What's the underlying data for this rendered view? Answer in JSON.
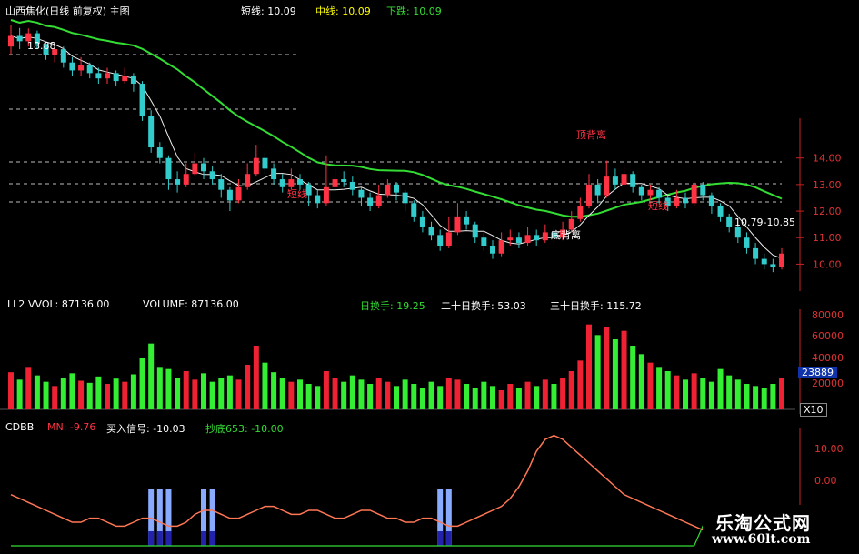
{
  "title": "山西焦化(日线 前复权) 主图",
  "legend_main": [
    {
      "label": "短线: 10.09",
      "color": "#ffffff"
    },
    {
      "label": "中线: 10.09",
      "color": "#ffff00"
    },
    {
      "label": "下跌: 10.09",
      "color": "#33dd33"
    }
  ],
  "annotations": {
    "high": "18.88",
    "short_line": "短线",
    "top_div": "顶背离",
    "bottom_div": "底背离",
    "range": "10.79-10.85",
    "short_line2": "短线"
  },
  "vol_header": {
    "name": "LL2",
    "vvol": "VVOL: 87136.00",
    "volume": "VOLUME: 87136.00",
    "t10": "日换手: 19.25",
    "t20": "二十日换手: 53.03",
    "t30": "三十日换手: 115.72"
  },
  "vol_axis": {
    "ticks": [
      "80000",
      "60000",
      "40000",
      "20000"
    ],
    "current": "23889",
    "unit": "X10"
  },
  "ind_header": {
    "name": "CDBB",
    "mn": "MN: -9.76",
    "buy": "买入信号: -10.03",
    "bottom": "抄底653: -10.00"
  },
  "ind_axis": {
    "ticks": [
      "10.00",
      "0.00"
    ]
  },
  "watermark": {
    "cn": "乐淘公式网",
    "url": "www.60lt.com"
  },
  "colors": {
    "up": "#ff3344",
    "down": "#33cccc",
    "vol_up": "#ee2233",
    "vol_down": "#33ee33",
    "axis": "#cc2222"
  },
  "chart_data": {
    "type": "candlestick",
    "price_axis": {
      "ticks": [
        14.0,
        13.0,
        12.0,
        11.0,
        10.0
      ],
      "ylim": [
        9.5,
        19.2
      ]
    },
    "candles": [
      [
        18.2,
        18.6,
        19.0,
        17.9
      ],
      [
        18.6,
        18.4,
        18.9,
        18.1
      ],
      [
        18.4,
        18.7,
        18.88,
        18.2
      ],
      [
        18.7,
        18.3,
        18.8,
        18.1
      ],
      [
        18.3,
        17.9,
        18.4,
        17.7
      ],
      [
        17.9,
        18.1,
        18.3,
        17.6
      ],
      [
        18.1,
        17.6,
        18.2,
        17.4
      ],
      [
        17.6,
        17.3,
        17.8,
        17.1
      ],
      [
        17.3,
        17.5,
        17.8,
        17.1
      ],
      [
        17.5,
        17.2,
        17.6,
        17.0
      ],
      [
        17.2,
        17.0,
        17.4,
        16.8
      ],
      [
        17.0,
        17.2,
        17.4,
        16.8
      ],
      [
        17.2,
        16.9,
        17.3,
        16.7
      ],
      [
        16.9,
        17.1,
        17.4,
        16.8
      ],
      [
        17.1,
        16.8,
        17.2,
        16.5
      ],
      [
        16.8,
        15.6,
        16.9,
        15.4
      ],
      [
        15.6,
        14.4,
        15.8,
        14.2
      ],
      [
        14.4,
        14.0,
        14.6,
        13.8
      ],
      [
        14.0,
        13.2,
        14.1,
        12.8
      ],
      [
        13.2,
        13.0,
        13.5,
        12.7
      ],
      [
        13.0,
        13.4,
        13.8,
        12.9
      ],
      [
        13.4,
        13.8,
        14.2,
        13.3
      ],
      [
        13.8,
        13.5,
        14.0,
        13.2
      ],
      [
        13.5,
        13.2,
        13.7,
        13.0
      ],
      [
        13.2,
        12.8,
        13.4,
        12.5
      ],
      [
        12.8,
        12.4,
        12.9,
        12.0
      ],
      [
        12.4,
        12.9,
        13.2,
        12.3
      ],
      [
        12.9,
        13.4,
        13.8,
        12.8
      ],
      [
        13.4,
        14.0,
        14.5,
        13.3
      ],
      [
        14.0,
        13.6,
        14.2,
        13.4
      ],
      [
        13.6,
        13.2,
        13.8,
        13.0
      ],
      [
        13.2,
        12.9,
        13.4,
        12.7
      ],
      [
        12.9,
        13.2,
        13.6,
        12.8
      ],
      [
        13.2,
        13.0,
        13.4,
        12.8
      ],
      [
        13.0,
        12.6,
        13.1,
        12.2
      ],
      [
        12.6,
        12.3,
        12.8,
        12.1
      ],
      [
        12.3,
        12.9,
        14.1,
        12.2
      ],
      [
        12.9,
        13.2,
        13.6,
        12.8
      ],
      [
        13.2,
        13.1,
        13.5,
        12.9
      ],
      [
        13.1,
        12.8,
        13.3,
        12.6
      ],
      [
        12.8,
        12.5,
        12.9,
        12.2
      ],
      [
        12.5,
        12.2,
        12.7,
        12.0
      ],
      [
        12.2,
        12.6,
        13.0,
        12.1
      ],
      [
        12.6,
        13.0,
        13.2,
        12.5
      ],
      [
        13.0,
        12.7,
        13.1,
        12.4
      ],
      [
        12.7,
        12.3,
        12.8,
        12.0
      ],
      [
        12.3,
        11.8,
        12.4,
        11.6
      ],
      [
        11.8,
        11.4,
        12.0,
        11.2
      ],
      [
        11.4,
        11.1,
        11.6,
        10.9
      ],
      [
        11.1,
        10.7,
        11.3,
        10.5
      ],
      [
        10.7,
        11.2,
        11.8,
        10.6
      ],
      [
        11.2,
        11.8,
        12.3,
        11.1
      ],
      [
        11.8,
        11.5,
        12.0,
        11.3
      ],
      [
        11.5,
        11.0,
        11.6,
        10.8
      ],
      [
        11.0,
        10.7,
        11.2,
        10.5
      ],
      [
        10.7,
        10.4,
        10.9,
        10.2
      ],
      [
        10.4,
        10.9,
        11.2,
        10.3
      ],
      [
        10.9,
        11.0,
        11.3,
        10.7
      ],
      [
        11.0,
        10.8,
        11.2,
        10.6
      ],
      [
        10.8,
        11.1,
        11.4,
        10.7
      ],
      [
        11.1,
        10.9,
        11.3,
        10.7
      ],
      [
        10.9,
        11.2,
        11.5,
        10.8
      ],
      [
        11.2,
        11.0,
        11.4,
        10.8
      ],
      [
        11.0,
        11.3,
        11.6,
        10.9
      ],
      [
        11.3,
        11.7,
        12.0,
        11.2
      ],
      [
        11.7,
        12.2,
        12.5,
        11.6
      ],
      [
        12.2,
        13.0,
        13.4,
        12.1
      ],
      [
        13.0,
        12.6,
        13.2,
        12.3
      ],
      [
        12.6,
        13.3,
        13.9,
        12.5
      ],
      [
        13.3,
        13.0,
        13.6,
        12.8
      ],
      [
        13.0,
        13.4,
        13.7,
        12.9
      ],
      [
        13.4,
        12.9,
        13.5,
        12.7
      ],
      [
        12.9,
        12.6,
        13.0,
        12.4
      ],
      [
        12.6,
        12.8,
        13.0,
        12.4
      ],
      [
        12.8,
        12.5,
        12.9,
        12.3
      ],
      [
        12.5,
        12.2,
        12.6,
        12.0
      ],
      [
        12.2,
        12.5,
        12.8,
        12.1
      ],
      [
        12.5,
        12.3,
        12.7,
        12.1
      ],
      [
        12.3,
        13.0,
        13.1,
        12.2
      ],
      [
        13.0,
        12.6,
        13.1,
        12.4
      ],
      [
        12.6,
        12.2,
        12.7,
        11.9
      ],
      [
        12.2,
        11.8,
        12.3,
        11.6
      ],
      [
        11.8,
        11.4,
        11.9,
        11.2
      ],
      [
        11.4,
        11.0,
        11.5,
        10.8
      ],
      [
        11.0,
        10.6,
        11.2,
        10.4
      ],
      [
        10.6,
        10.2,
        10.8,
        10.0
      ],
      [
        10.2,
        10.0,
        10.4,
        9.8
      ],
      [
        10.0,
        9.9,
        10.2,
        9.7
      ],
      [
        9.9,
        10.4,
        10.6,
        9.8
      ]
    ],
    "volume": [
      35,
      28,
      40,
      32,
      26,
      22,
      30,
      34,
      27,
      25,
      31,
      24,
      29,
      26,
      33,
      48,
      62,
      40,
      38,
      30,
      36,
      28,
      34,
      26,
      30,
      32,
      28,
      42,
      60,
      44,
      35,
      30,
      26,
      28,
      24,
      22,
      36,
      30,
      26,
      32,
      28,
      24,
      30,
      26,
      22,
      28,
      24,
      20,
      26,
      22,
      30,
      28,
      24,
      20,
      26,
      22,
      18,
      24,
      20,
      26,
      22,
      28,
      24,
      30,
      36,
      46,
      80,
      70,
      78,
      66,
      74,
      60,
      52,
      44,
      40,
      36,
      32,
      28,
      34,
      30,
      26,
      38,
      32,
      28,
      24,
      22,
      20,
      24,
      30
    ],
    "indicator": [
      -1,
      -2,
      -3,
      -4,
      -5,
      -6,
      -7,
      -8,
      -8,
      -7,
      -7,
      -8,
      -9,
      -9,
      -8,
      -7,
      -7,
      -8,
      -9,
      -9,
      -8,
      -6,
      -5,
      -5,
      -6,
      -7,
      -7,
      -6,
      -5,
      -4,
      -4,
      -5,
      -6,
      -6,
      -5,
      -5,
      -6,
      -7,
      -7,
      -6,
      -5,
      -5,
      -6,
      -7,
      -7,
      -8,
      -8,
      -7,
      -7,
      -8,
      -9,
      -9,
      -8,
      -7,
      -6,
      -5,
      -4,
      -2,
      1,
      5,
      10,
      13,
      14,
      13,
      11,
      9,
      7,
      5,
      3,
      1,
      -1,
      -2,
      -3,
      -4,
      -5,
      -6,
      -7,
      -8,
      -9,
      -10,
      -10,
      -11,
      -11,
      -11,
      -11,
      -11,
      -12,
      -12,
      -12
    ],
    "signal_bars": [
      16,
      17,
      18,
      22,
      23,
      49,
      50
    ],
    "series": [
      {
        "name": "中线"
      },
      {
        "name": "下跌"
      }
    ]
  }
}
